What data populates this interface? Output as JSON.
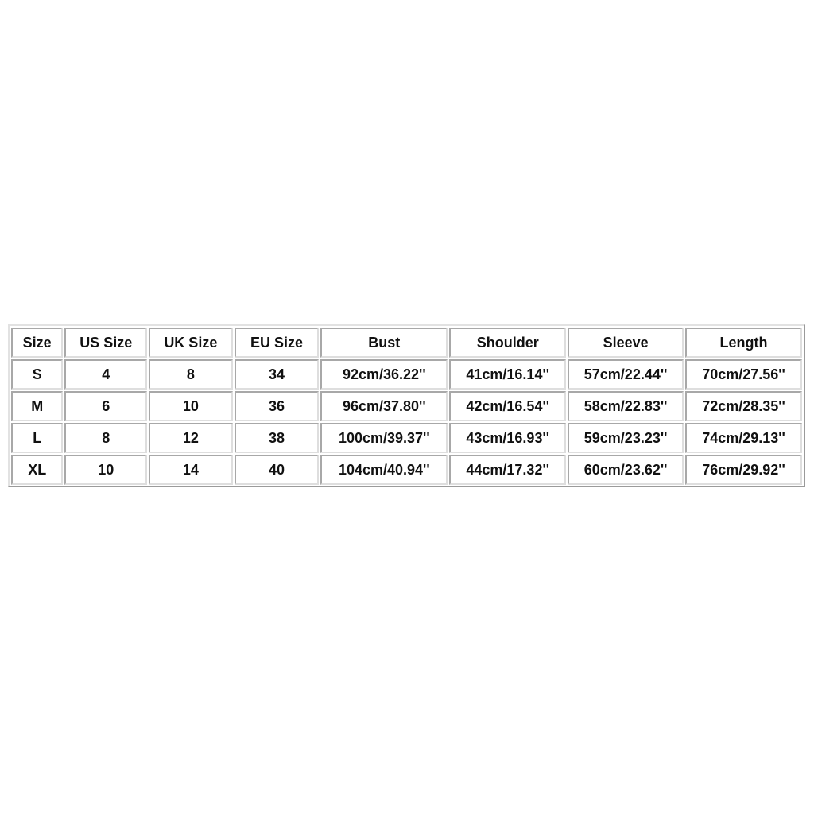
{
  "size_chart": {
    "headers": [
      "Size",
      "US Size",
      "UK Size",
      "EU Size",
      "Bust",
      "Shoulder",
      "Sleeve",
      "Length"
    ],
    "rows": [
      [
        "S",
        "4",
        "8",
        "34",
        "92cm/36.22''",
        "41cm/16.14''",
        "57cm/22.44''",
        "70cm/27.56''"
      ],
      [
        "M",
        "6",
        "10",
        "36",
        "96cm/37.80''",
        "42cm/16.54''",
        "58cm/22.83''",
        "72cm/28.35''"
      ],
      [
        "L",
        "8",
        "12",
        "38",
        "100cm/39.37''",
        "43cm/16.93''",
        "59cm/23.23''",
        "74cm/29.13''"
      ],
      [
        "XL",
        "10",
        "14",
        "40",
        "104cm/40.94''",
        "44cm/17.32''",
        "60cm/23.62''",
        "76cm/29.92''"
      ]
    ]
  }
}
